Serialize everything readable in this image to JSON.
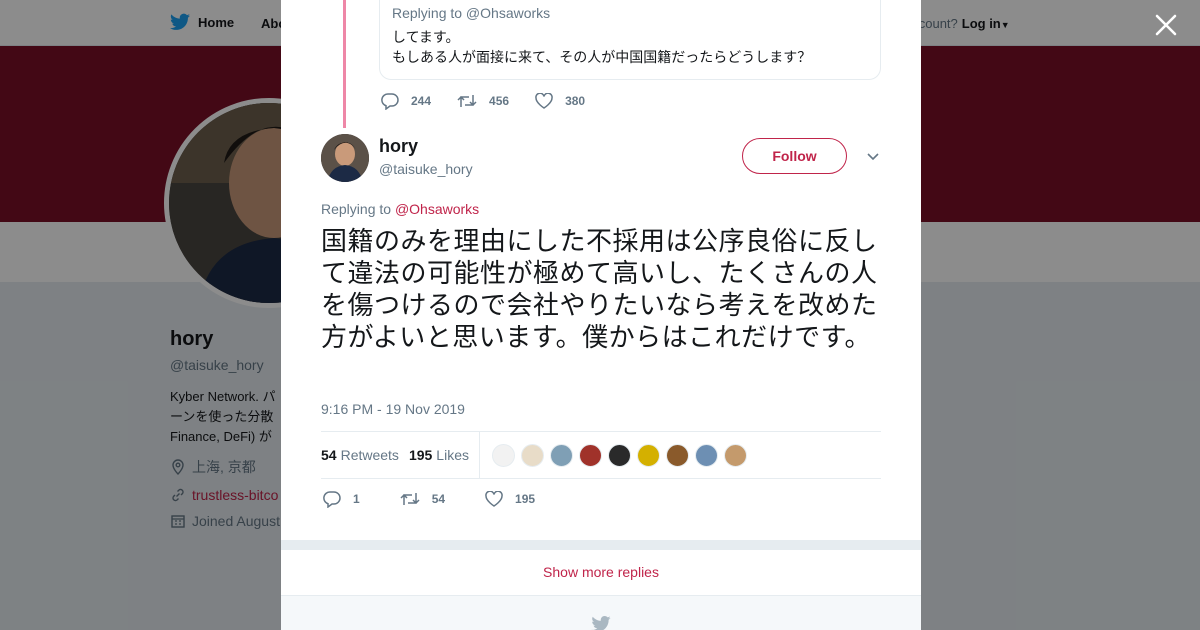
{
  "topbar": {
    "home_label": "Home",
    "about_label": "Abo",
    "account_prompt": "account?",
    "login_label": "Log in"
  },
  "profile": {
    "name": "hory",
    "handle": "@taisuke_hory",
    "bio_line1": "Kyber Network. パ",
    "bio_line2": "ーンを使った分散",
    "bio_line3": "Finance, DeFi) が",
    "location": "上海, 京都",
    "website": "trustless-bitco",
    "joined": "Joined August"
  },
  "previous_tweet": {
    "replying_to": "Replying to @Ohsaworks",
    "text_line1": "してます。",
    "text_line2": "もしある人が面接に来て、その人が中国国籍だったらどうします？",
    "replies": "244",
    "retweets": "456",
    "likes": "380"
  },
  "tweet": {
    "author_name": "hory",
    "author_handle": "@taisuke_hory",
    "follow_label": "Follow",
    "replying_prefix": "Replying to",
    "replying_handle": "@Ohsaworks",
    "text": "国籍のみを理由にした不採用は公序良俗に反して違法の可能性が極めて高いし、たくさんの人を傷つけるので会社やりたいなら考えを改めた方がよいと思います。僕からはこれだけです。",
    "timestamp": "9:16 PM - 19 Nov 2019",
    "retweet_count": "54",
    "retweets_label": "Retweets",
    "like_count": "195",
    "likes_label": "Likes",
    "action_replies": "1",
    "action_retweets": "54",
    "action_likes": "195",
    "liker_colors": [
      "#f2f2f2",
      "#e8dcc8",
      "#7f9fb5",
      "#a0322a",
      "#2a2a2a",
      "#d4b000",
      "#8a5a2b",
      "#6d8fb3",
      "#c49a6c"
    ]
  },
  "show_more_label": "Show more replies",
  "colors": {
    "accent": "#c0244a",
    "banner": "#7b1027",
    "twitter_blue": "#1da1f2"
  }
}
